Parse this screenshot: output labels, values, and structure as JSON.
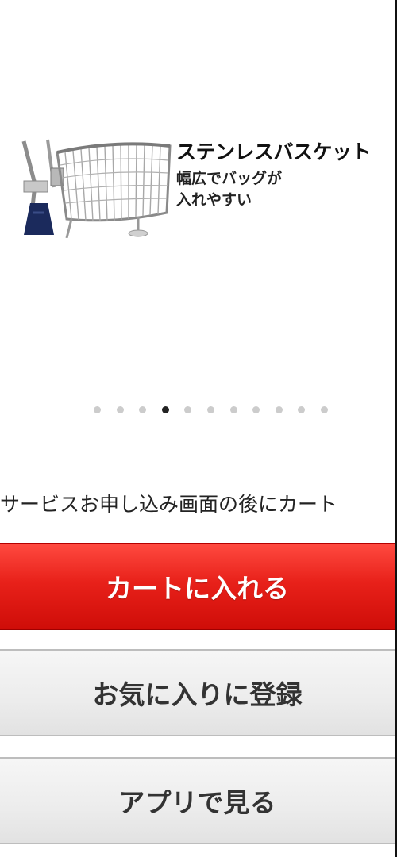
{
  "slide": {
    "title": "ステンレスバスケット",
    "desc_line1": "幅広でバッグが",
    "desc_line2": "入れやすい",
    "image_icon": "stainless-wire-basket-image"
  },
  "pagination": {
    "total": 11,
    "active_index": 3
  },
  "notice": {
    "text": "サービスお申し込み画面の後にカート"
  },
  "buttons": {
    "cart": "カートに入れる",
    "favorite": "お気に入りに登録",
    "app": "アプリで見る"
  },
  "colors": {
    "cart_button": "#e8211a",
    "secondary_button": "#ececec",
    "active_dot": "#222222",
    "inactive_dot": "#cccccc"
  }
}
